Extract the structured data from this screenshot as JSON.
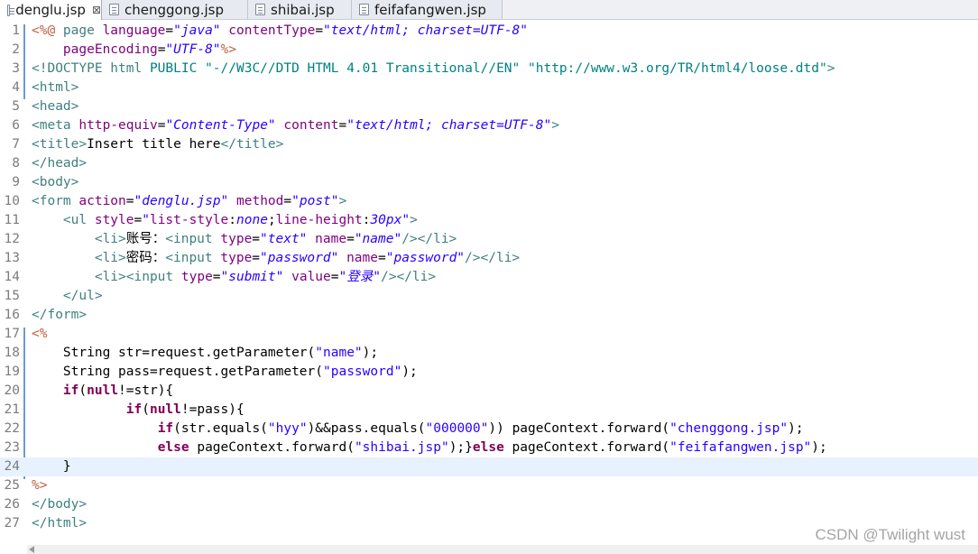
{
  "colors": {
    "plain": "#000000",
    "tag": "#3f7f7f",
    "attr": "#7f007f",
    "value": "#2a00ff",
    "keyword": "#7f0055",
    "doctype": "#008080",
    "scriptlet": "#bf5f3f"
  },
  "tabs": [
    {
      "label": "denglu.jsp",
      "active": true,
      "close": "⊠"
    },
    {
      "label": "chenggong.jsp",
      "active": false
    },
    {
      "label": "shibai.jsp",
      "active": false
    },
    {
      "label": "feifafangwen.jsp",
      "active": false
    }
  ],
  "editor": {
    "current_line": 24,
    "lines": [
      {
        "n": "1",
        "segs": [
          [
            "<%@ ",
            "scriptlet",
            ""
          ],
          [
            "page ",
            "tag",
            ""
          ],
          [
            "language",
            "attr",
            ""
          ],
          [
            "=",
            "plain",
            ""
          ],
          [
            "\"java\"",
            "value",
            "i"
          ],
          [
            " ",
            "plain",
            ""
          ],
          [
            "contentType",
            "attr",
            ""
          ],
          [
            "=",
            "plain",
            ""
          ],
          [
            "\"text/html; charset=UTF-8\"",
            "value",
            "i"
          ]
        ]
      },
      {
        "n": "2",
        "segs": [
          [
            "    ",
            "plain",
            ""
          ],
          [
            "pageEncoding",
            "attr",
            ""
          ],
          [
            "=",
            "plain",
            ""
          ],
          [
            "\"UTF-8\"",
            "value",
            "i"
          ],
          [
            "%>",
            "scriptlet",
            ""
          ]
        ]
      },
      {
        "n": "3",
        "segs": [
          [
            "<!DOCTYPE html ",
            "tag",
            ""
          ],
          [
            "PUBLIC ",
            "doctype",
            ""
          ],
          [
            "\"-//W3C//DTD HTML 4.01 Transitional//EN\"",
            "doctype",
            ""
          ],
          [
            " ",
            "plain",
            ""
          ],
          [
            "\"http://www.w3.org/TR/html4/loose.dtd\"",
            "doctype",
            ""
          ],
          [
            ">",
            "tag",
            ""
          ]
        ]
      },
      {
        "n": "4",
        "segs": [
          [
            "<html>",
            "tag",
            ""
          ]
        ]
      },
      {
        "n": "5",
        "segs": [
          [
            "<head>",
            "tag",
            ""
          ]
        ]
      },
      {
        "n": "6",
        "segs": [
          [
            "<meta ",
            "tag",
            ""
          ],
          [
            "http-equiv",
            "attr",
            ""
          ],
          [
            "=",
            "plain",
            ""
          ],
          [
            "\"Content-Type\"",
            "value",
            "i"
          ],
          [
            " ",
            "plain",
            ""
          ],
          [
            "content",
            "attr",
            ""
          ],
          [
            "=",
            "plain",
            ""
          ],
          [
            "\"text/html; charset=UTF-8\"",
            "value",
            "i"
          ],
          [
            ">",
            "tag",
            ""
          ]
        ]
      },
      {
        "n": "7",
        "segs": [
          [
            "<title>",
            "tag",
            ""
          ],
          [
            "Insert title here",
            "plain",
            ""
          ],
          [
            "</title>",
            "tag",
            ""
          ]
        ]
      },
      {
        "n": "8",
        "segs": [
          [
            "</head>",
            "tag",
            ""
          ]
        ]
      },
      {
        "n": "9",
        "segs": [
          [
            "<body>",
            "tag",
            ""
          ]
        ]
      },
      {
        "n": "10",
        "segs": [
          [
            "<form ",
            "tag",
            ""
          ],
          [
            "action",
            "attr",
            ""
          ],
          [
            "=",
            "plain",
            ""
          ],
          [
            "\"denglu.jsp\"",
            "value",
            "i"
          ],
          [
            " ",
            "plain",
            ""
          ],
          [
            "method",
            "attr",
            ""
          ],
          [
            "=",
            "plain",
            ""
          ],
          [
            "\"post\"",
            "value",
            "i"
          ],
          [
            ">",
            "tag",
            ""
          ]
        ]
      },
      {
        "n": "11",
        "segs": [
          [
            "    ",
            "plain",
            ""
          ],
          [
            "<ul ",
            "tag",
            ""
          ],
          [
            "style",
            "attr",
            ""
          ],
          [
            "=",
            "plain",
            ""
          ],
          [
            "\"",
            "value",
            ""
          ],
          [
            "list-style",
            "attr",
            ""
          ],
          [
            ":",
            "plain",
            ""
          ],
          [
            "none",
            "value",
            "i"
          ],
          [
            ";",
            "plain",
            ""
          ],
          [
            "line-height",
            "attr",
            ""
          ],
          [
            ":",
            "plain",
            ""
          ],
          [
            "30px",
            "value",
            "i"
          ],
          [
            "\"",
            "value",
            ""
          ],
          [
            ">",
            "tag",
            ""
          ]
        ]
      },
      {
        "n": "12",
        "segs": [
          [
            "        ",
            "plain",
            ""
          ],
          [
            "<li>",
            "tag",
            ""
          ],
          [
            "账号：",
            "plain",
            ""
          ],
          [
            "<input ",
            "tag",
            ""
          ],
          [
            "type",
            "attr",
            ""
          ],
          [
            "=",
            "plain",
            ""
          ],
          [
            "\"text\"",
            "value",
            "i"
          ],
          [
            " ",
            "plain",
            ""
          ],
          [
            "name",
            "attr",
            ""
          ],
          [
            "=",
            "plain",
            ""
          ],
          [
            "\"name\"",
            "value",
            "i"
          ],
          [
            "/>",
            "tag",
            ""
          ],
          [
            "</li>",
            "tag",
            ""
          ]
        ]
      },
      {
        "n": "13",
        "segs": [
          [
            "        ",
            "plain",
            ""
          ],
          [
            "<li>",
            "tag",
            ""
          ],
          [
            "密码：",
            "plain",
            ""
          ],
          [
            "<input ",
            "tag",
            ""
          ],
          [
            "type",
            "attr",
            ""
          ],
          [
            "=",
            "plain",
            ""
          ],
          [
            "\"password\"",
            "value",
            "i"
          ],
          [
            " ",
            "plain",
            ""
          ],
          [
            "name",
            "attr",
            ""
          ],
          [
            "=",
            "plain",
            ""
          ],
          [
            "\"password\"",
            "value",
            "i"
          ],
          [
            "/>",
            "tag",
            ""
          ],
          [
            "</li>",
            "tag",
            ""
          ]
        ]
      },
      {
        "n": "14",
        "segs": [
          [
            "        ",
            "plain",
            ""
          ],
          [
            "<li>",
            "tag",
            ""
          ],
          [
            "<input ",
            "tag",
            ""
          ],
          [
            "type",
            "attr",
            ""
          ],
          [
            "=",
            "plain",
            ""
          ],
          [
            "\"submit\"",
            "value",
            "i"
          ],
          [
            " ",
            "plain",
            ""
          ],
          [
            "value",
            "attr",
            ""
          ],
          [
            "=",
            "plain",
            ""
          ],
          [
            "\"登录\"",
            "value",
            "i"
          ],
          [
            "/>",
            "tag",
            ""
          ],
          [
            "</li>",
            "tag",
            ""
          ]
        ]
      },
      {
        "n": "15",
        "segs": [
          [
            "    ",
            "plain",
            ""
          ],
          [
            "</ul>",
            "tag",
            ""
          ]
        ]
      },
      {
        "n": "16",
        "segs": [
          [
            "</form>",
            "tag",
            ""
          ]
        ]
      },
      {
        "n": "17",
        "segs": [
          [
            "<%",
            "scriptlet",
            ""
          ]
        ]
      },
      {
        "n": "18",
        "segs": [
          [
            "    String str=request.getParameter(",
            "plain",
            ""
          ],
          [
            "\"name\"",
            "value",
            ""
          ],
          [
            ");",
            "plain",
            ""
          ]
        ]
      },
      {
        "n": "19",
        "segs": [
          [
            "    String pass=request.getParameter(",
            "plain",
            ""
          ],
          [
            "\"password\"",
            "value",
            ""
          ],
          [
            ");",
            "plain",
            ""
          ]
        ]
      },
      {
        "n": "20",
        "segs": [
          [
            "    ",
            "plain",
            ""
          ],
          [
            "if",
            "keyword",
            "b"
          ],
          [
            "(",
            "plain",
            ""
          ],
          [
            "null",
            "keyword",
            "b"
          ],
          [
            "!=str){",
            "plain",
            ""
          ]
        ]
      },
      {
        "n": "21",
        "segs": [
          [
            "            ",
            "plain",
            ""
          ],
          [
            "if",
            "keyword",
            "b"
          ],
          [
            "(",
            "plain",
            ""
          ],
          [
            "null",
            "keyword",
            "b"
          ],
          [
            "!=pass){",
            "plain",
            ""
          ]
        ]
      },
      {
        "n": "22",
        "segs": [
          [
            "                ",
            "plain",
            ""
          ],
          [
            "if",
            "keyword",
            "b"
          ],
          [
            "(str.equals(",
            "plain",
            ""
          ],
          [
            "\"hyy\"",
            "value",
            ""
          ],
          [
            ")&&pass.equals(",
            "plain",
            ""
          ],
          [
            "\"000000\"",
            "value",
            ""
          ],
          [
            ")) pageContext.forward(",
            "plain",
            ""
          ],
          [
            "\"chenggong.jsp\"",
            "value",
            ""
          ],
          [
            ");",
            "plain",
            ""
          ]
        ]
      },
      {
        "n": "23",
        "segs": [
          [
            "                ",
            "plain",
            ""
          ],
          [
            "else",
            "keyword",
            "b"
          ],
          [
            " pageContext.forward(",
            "plain",
            ""
          ],
          [
            "\"shibai.jsp\"",
            "value",
            ""
          ],
          [
            ");}",
            "plain",
            ""
          ],
          [
            "else",
            "keyword",
            "b"
          ],
          [
            " pageContext.forward(",
            "plain",
            ""
          ],
          [
            "\"feifafangwen.jsp\"",
            "value",
            ""
          ],
          [
            ");",
            "plain",
            ""
          ]
        ]
      },
      {
        "n": "24",
        "segs": [
          [
            "    }",
            "plain",
            ""
          ]
        ]
      },
      {
        "n": "25",
        "segs": [
          [
            "%>",
            "scriptlet",
            ""
          ]
        ]
      },
      {
        "n": "26",
        "segs": [
          [
            "</body>",
            "tag",
            ""
          ]
        ]
      },
      {
        "n": "27",
        "segs": [
          [
            "</html>",
            "tag",
            ""
          ]
        ]
      }
    ]
  },
  "watermark": "CSDN @Twilight wust"
}
